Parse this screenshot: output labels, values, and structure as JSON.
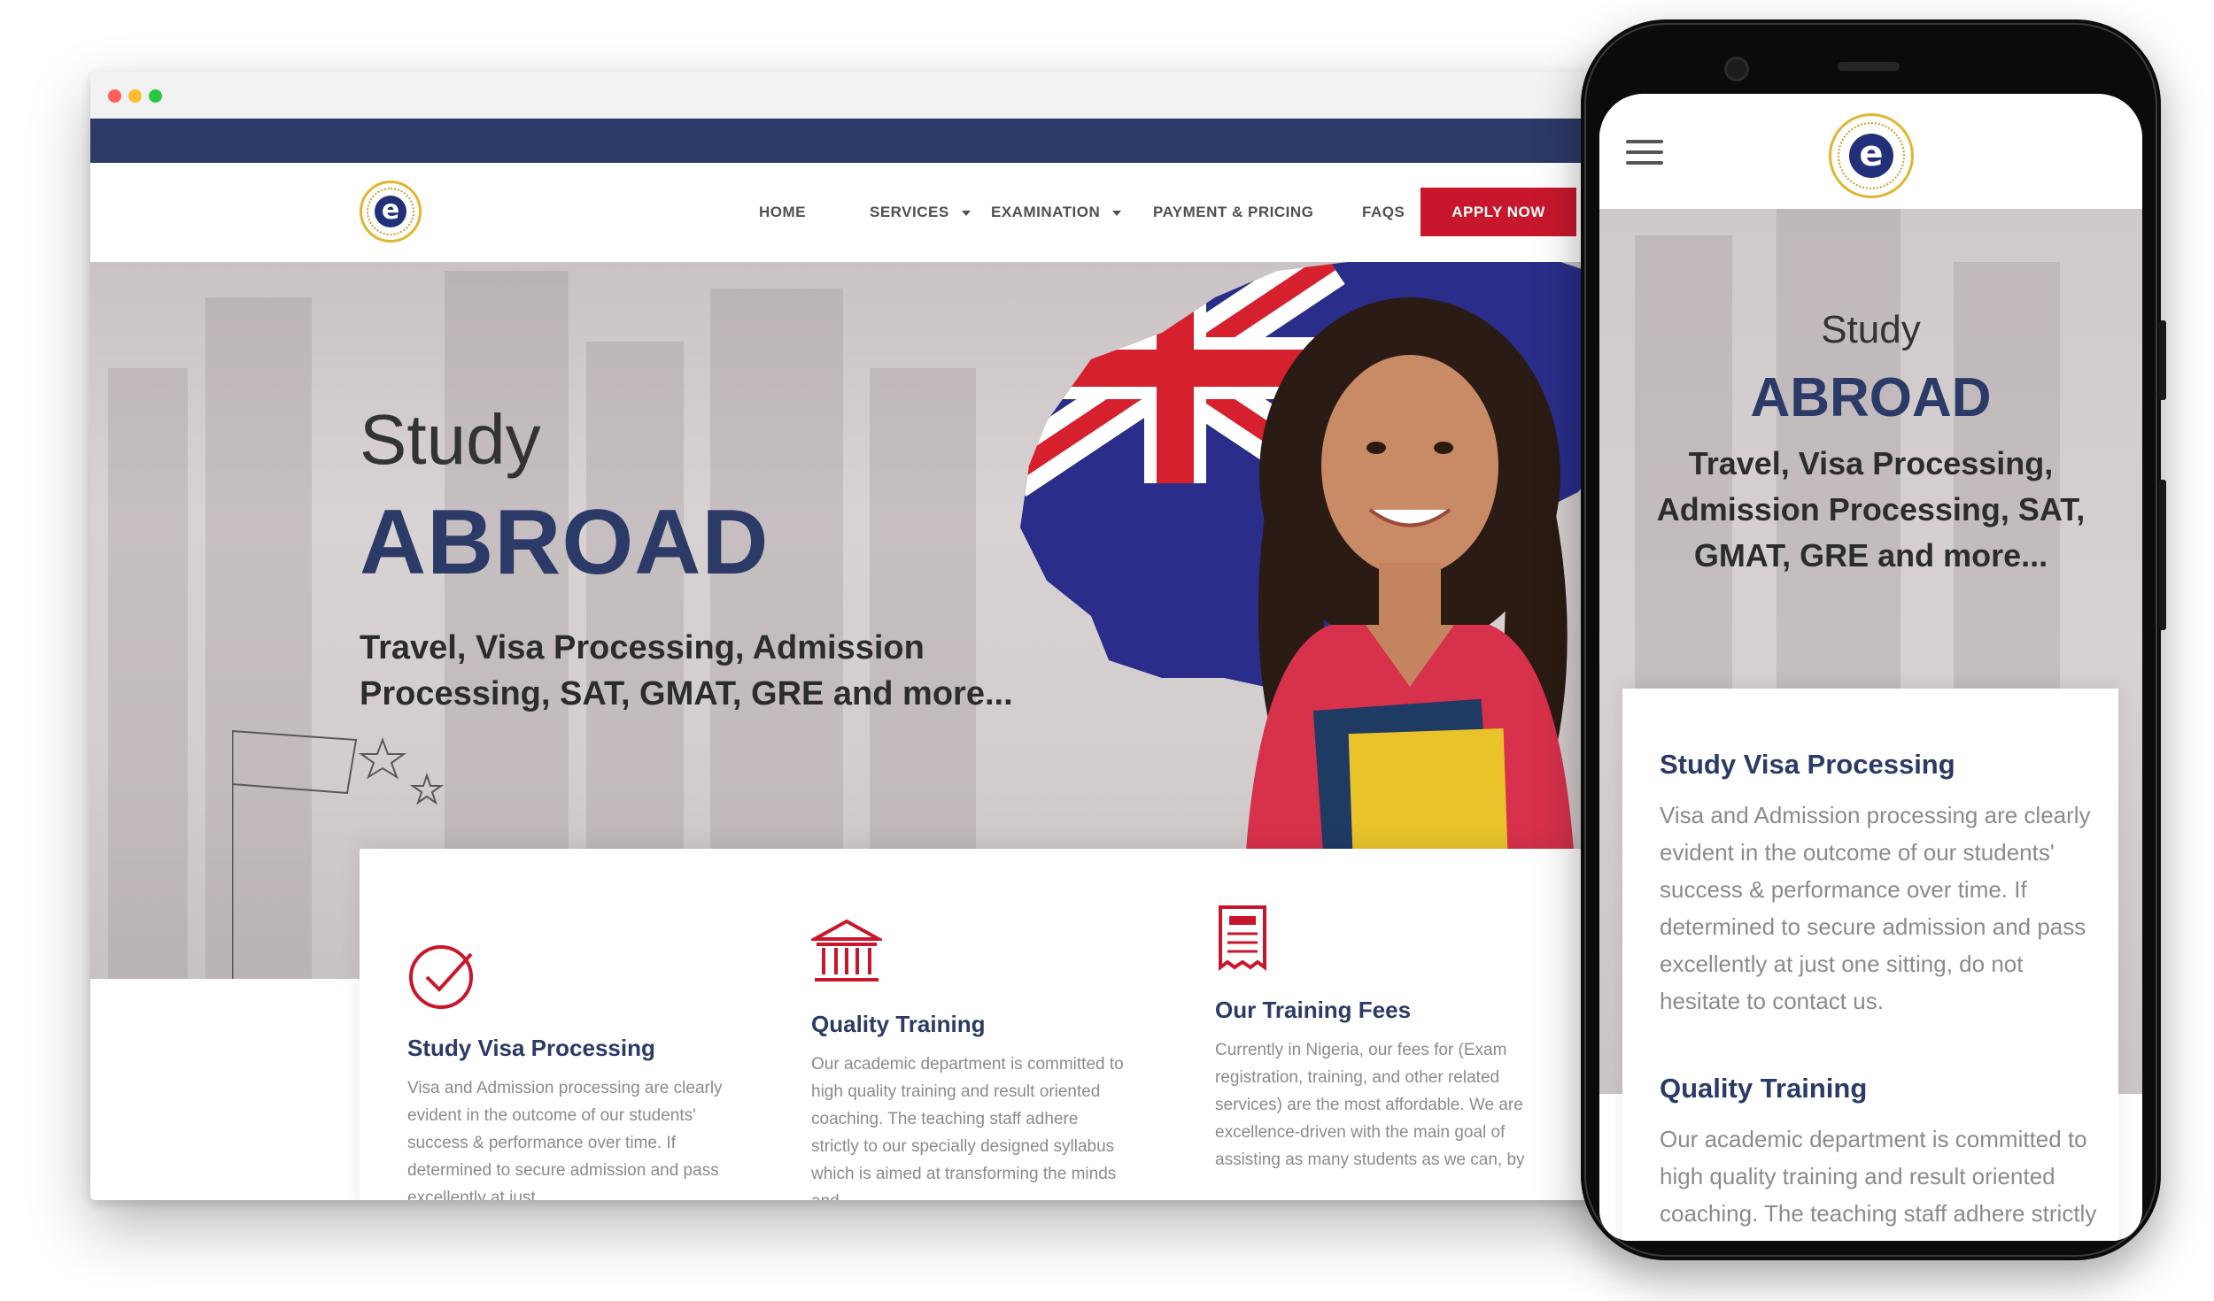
{
  "nav": {
    "logo_letter": "e",
    "items": [
      {
        "label": "HOME",
        "dropdown": false
      },
      {
        "label": "SERVICES",
        "dropdown": true
      },
      {
        "label": "EXAMINATION",
        "dropdown": true
      },
      {
        "label": "PAYMENT & PRICING",
        "dropdown": false
      },
      {
        "label": "FAQS",
        "dropdown": false
      }
    ],
    "cta_label": "APPLY NOW"
  },
  "hero": {
    "line1": "Study",
    "line2": "ABROAD",
    "subtitle": "Travel, Visa Processing, Admission Processing, SAT, GMAT, GRE and more..."
  },
  "features": [
    {
      "icon": "check-circle-icon",
      "title": "Study Visa Processing",
      "desc": "Visa and Admission processing are clearly evident in the outcome of our students' success & performance over time. If determined to secure admission and pass excellently at just"
    },
    {
      "icon": "institution-icon",
      "title": "Quality Training",
      "desc": "Our academic department is committed to high quality training and result oriented coaching. The teaching staff adhere strictly to our specially designed syllabus which is aimed at transforming the minds and"
    },
    {
      "icon": "receipt-icon",
      "title": "Our Training Fees",
      "desc": "Currently in Nigeria, our fees for (Exam registration, training, and other related services) are the most affordable. We are excellence-driven with the main goal of assisting as many students as we can, by"
    }
  ],
  "mobile": {
    "hero": {
      "line1": "Study",
      "line2": "ABROAD",
      "subtitle": "Travel, Visa Processing, Admission Processing, SAT, GMAT, GRE and more..."
    },
    "features": [
      {
        "title": "Study Visa Processing",
        "desc": "Visa and Admission processing are clearly evident in the outcome of our students' success & performance over time. If determined to secure admission and pass excellently at just one sitting, do not hesitate to contact us."
      },
      {
        "title": "Quality Training",
        "desc": "Our academic department is committed to high quality training and result oriented coaching. The teaching staff adhere strictly to our specially designed"
      }
    ]
  },
  "colors": {
    "brand_navy": "#2b3a67",
    "cta_red": "#c8172c",
    "logo_gold": "#e1b530"
  }
}
